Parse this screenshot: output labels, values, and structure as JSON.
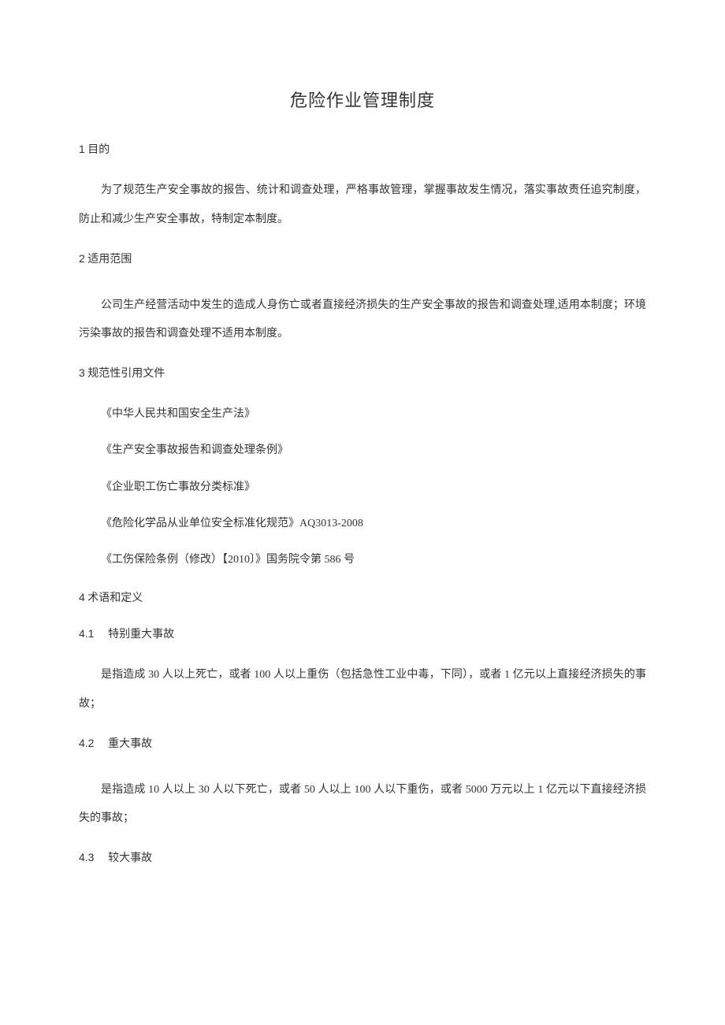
{
  "title": "危险作业管理制度",
  "sections": {
    "s1": {
      "heading_num": "1",
      "heading_text": "目的",
      "body": "为了规范生产安全事故的报告、统计和调查处理，严格事故管理，掌握事故发生情况，落实事故责任追究制度，防止和减少生产安全事故，特制定本制度。"
    },
    "s2": {
      "heading_num": "2",
      "heading_text": "适用范围",
      "body": "公司生产经营活动中发生的造成人身伤亡或者直接经济损失的生产安全事故的报告和调查处理,适用本制度；环境污染事故的报告和调查处理不适用本制度。"
    },
    "s3": {
      "heading_num": "3",
      "heading_text": "规范性引用文件",
      "refs": [
        "《中华人民共和国安全生产法》",
        "《生产安全事故报告和调查处理条例》",
        "《企业职工伤亡事故分类标准》",
        "《危险化学品从业单位安全标准化规范》AQ3013-2008",
        "《工伤保险条例（修改）【2010〕》国务院令第 586 号"
      ]
    },
    "s4": {
      "heading_num": "4",
      "heading_text": "术语和定义",
      "subs": {
        "s41": {
          "num": "4.1",
          "label": "特别重大事故",
          "body": "是指造成 30 人以上死亡，或者 100 人以上重伤（包括急性工业中毒，下同），或者 1 亿元以上直接经济损失的事故；"
        },
        "s42": {
          "num": "4.2",
          "label": "重大事故",
          "body": "是指造成 10 人以上 30 人以下死亡，或者 50 人以上 100 人以下重伤，或者 5000 万元以上 1 亿元以下直接经济损失的事故；"
        },
        "s43": {
          "num": "4.3",
          "label": "较大事故"
        }
      }
    }
  }
}
